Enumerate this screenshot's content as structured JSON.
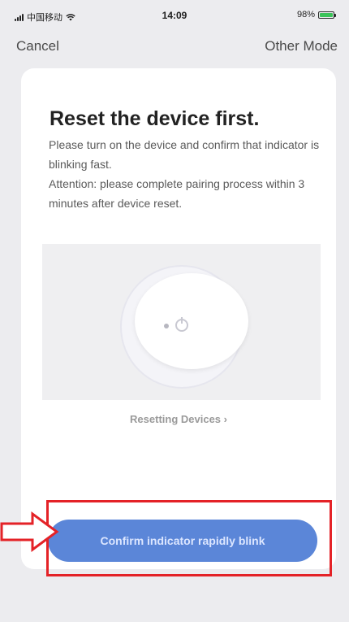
{
  "status_bar": {
    "carrier": "中国移动",
    "time": "14:09",
    "battery": "98%"
  },
  "nav": {
    "cancel": "Cancel",
    "other_mode": "Other Mode"
  },
  "card": {
    "title": "Reset the device first.",
    "instruction": "Please turn on the device and confirm that indicator is blinking fast.",
    "attention": "Attention: please complete pairing process within 3 minutes after device reset.",
    "reset_link": "Resetting Devices ›"
  },
  "confirm_button": {
    "label": "Confirm indicator rapidly blink"
  },
  "colors": {
    "primary": "#5b86d8",
    "highlight": "#e42227",
    "background": "#ececef"
  },
  "icons": [
    "signal-icon",
    "wifi-icon",
    "battery-icon",
    "power-icon",
    "pointer-arrow-icon"
  ]
}
